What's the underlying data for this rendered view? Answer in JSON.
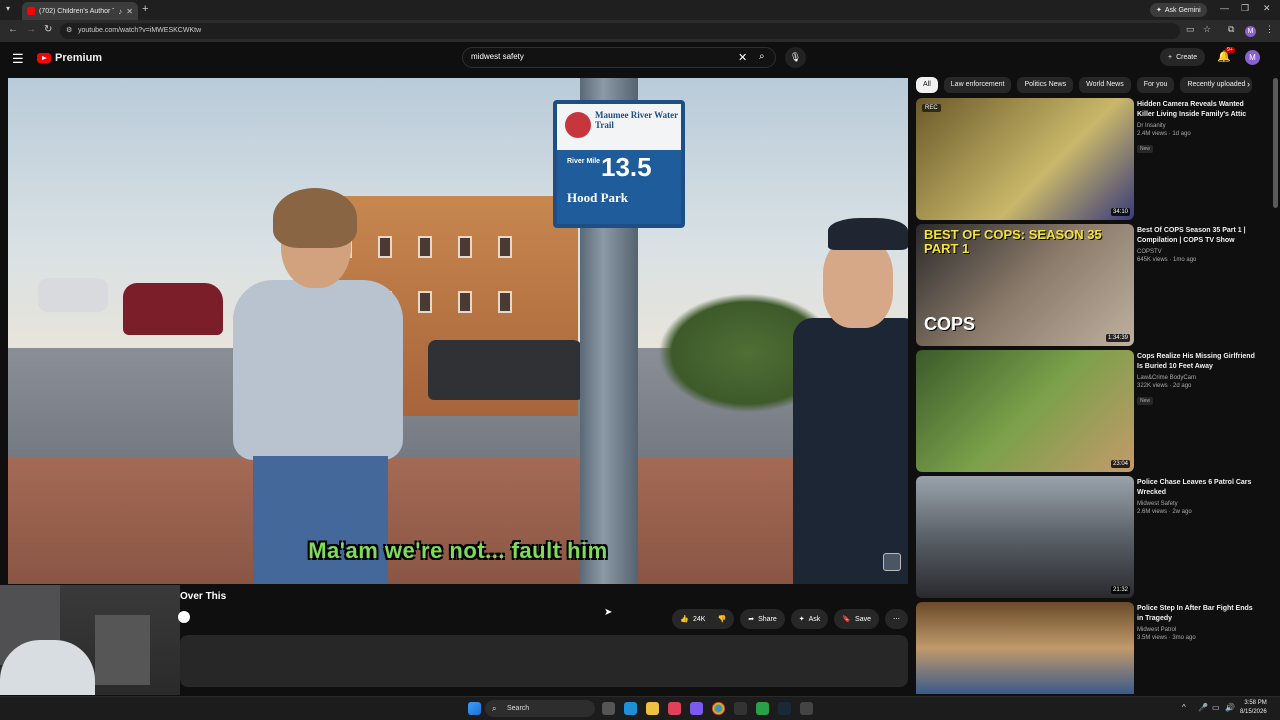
{
  "browser": {
    "tab_title": "(702) Children's Author Th",
    "url": "youtube.com/watch?v=iMWESKCWKtw",
    "ask_gemini": "Ask Gemini",
    "profile_initial": "M"
  },
  "header": {
    "logo_text": "Premium",
    "search_query": "midwest safety",
    "create_label": "Create",
    "notif_count": "9+",
    "avatar_initial": "M"
  },
  "video": {
    "sign_name": "Maumee River Water Trail",
    "sign_mile_label": "River Mile",
    "sign_mile": "13.5",
    "sign_park": "Hood Park",
    "subtitle": "Ma'am we're not... fault him",
    "title": "Over This"
  },
  "actions": {
    "likes": "24K",
    "share": "Share",
    "ask": "Ask",
    "save": "Save"
  },
  "chips": [
    "All",
    "Law enforcement",
    "Politics News",
    "World News",
    "For you",
    "Recently uploaded"
  ],
  "recommendations": [
    {
      "title": "Hidden Camera Reveals Wanted Killer Living Inside Family's Attic",
      "channel": "Dr Insanity",
      "meta": "2.4M views · 1d ago",
      "badge": "New",
      "duration": "34:10",
      "thumb_rec": "REC",
      "thumb_text": "",
      "thumb_text2": ""
    },
    {
      "title": "Best Of COPS Season 35 Part 1 | Compilation | COPS TV Show",
      "channel": "COPSTV",
      "meta": "645K views · 1mo ago",
      "badge": "",
      "duration": "1:34:39",
      "thumb_rec": "",
      "thumb_text": "BEST OF COPS: SEASON 35 PART 1",
      "thumb_text2": "COPS"
    },
    {
      "title": "Cops Realize His Missing Girlfriend Is Buried 10 Feet Away",
      "channel": "Law&Crime BodyCam",
      "meta": "322K views · 2d ago",
      "badge": "New",
      "duration": "23:04",
      "thumb_rec": "",
      "thumb_text": "",
      "thumb_text2": ""
    },
    {
      "title": "Police Chase Leaves 6 Patrol Cars Wrecked",
      "channel": "Midwest Safety",
      "meta": "2.6M views · 2w ago",
      "badge": "",
      "duration": "21:32",
      "thumb_rec": "",
      "thumb_text": "",
      "thumb_text2": ""
    },
    {
      "title": "Police Step In After Bar Fight Ends in Tragedy",
      "channel": "Midwest Patrol",
      "meta": "3.5M views · 3mo ago",
      "badge": "",
      "duration": "",
      "thumb_rec": "",
      "thumb_text": "",
      "thumb_text2": ""
    }
  ],
  "taskbar": {
    "search_label": "Search",
    "time": "3:58 PM",
    "date": "8/15/2026"
  },
  "colors": {
    "subtitle": "#7fdc5a",
    "brand": "#ff0000",
    "background": "#0f0f0f"
  }
}
